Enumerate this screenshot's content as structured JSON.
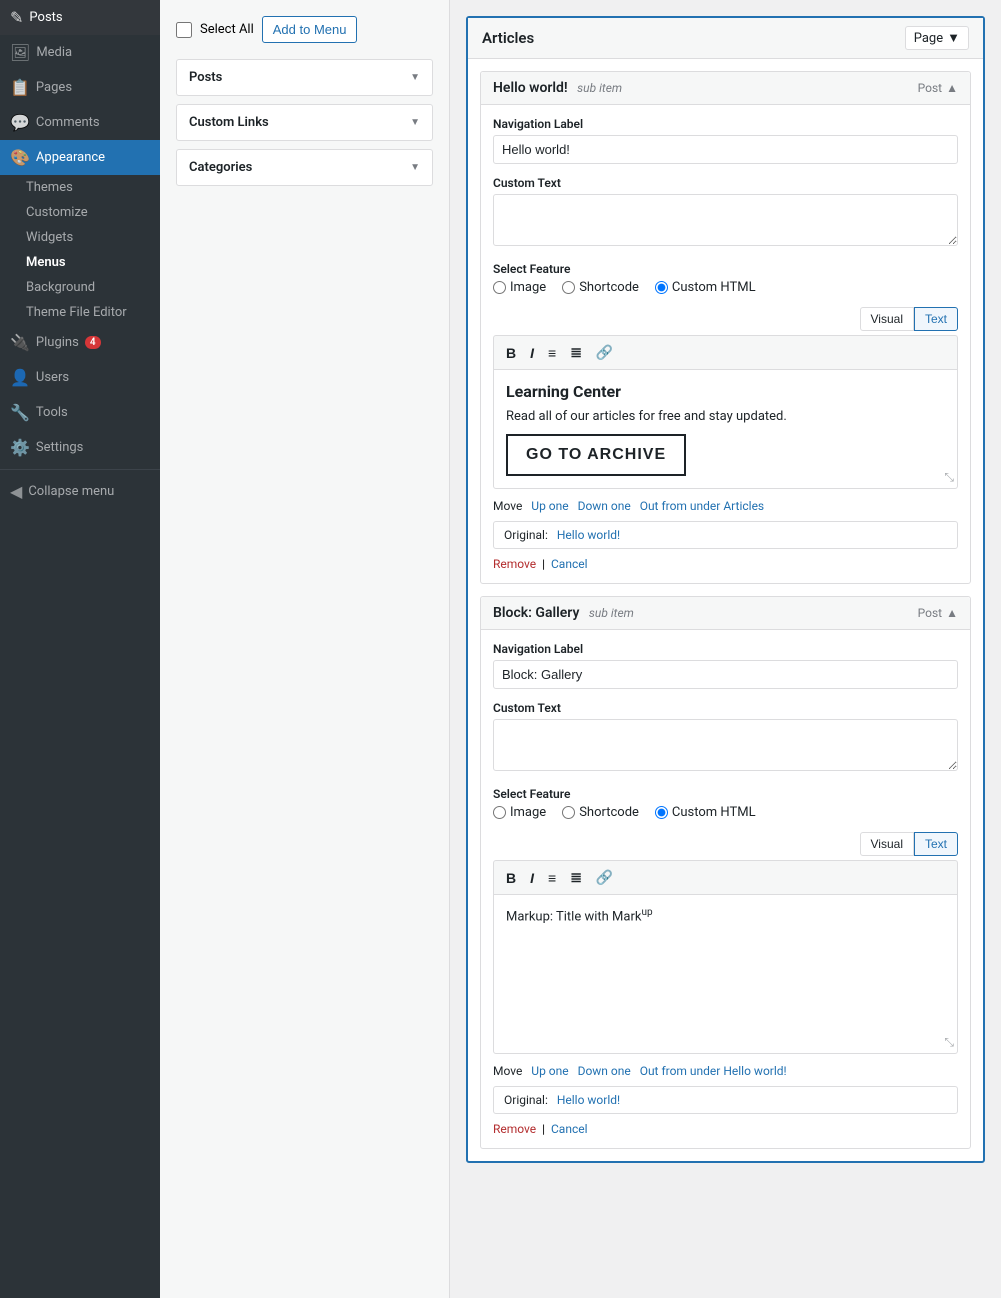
{
  "sidebar": {
    "items": [
      {
        "id": "posts",
        "label": "Posts",
        "icon": "📄",
        "badge": null
      },
      {
        "id": "media",
        "label": "Media",
        "icon": "🖼",
        "badge": null
      },
      {
        "id": "pages",
        "label": "Pages",
        "icon": "📋",
        "badge": null
      },
      {
        "id": "comments",
        "label": "Comments",
        "icon": "💬",
        "badge": null
      },
      {
        "id": "appearance",
        "label": "Appearance",
        "icon": "🎨",
        "badge": null,
        "active": true
      },
      {
        "id": "plugins",
        "label": "Plugins",
        "icon": "🔌",
        "badge": "4"
      },
      {
        "id": "users",
        "label": "Users",
        "icon": "👤",
        "badge": null
      },
      {
        "id": "tools",
        "label": "Tools",
        "icon": "🔧",
        "badge": null
      },
      {
        "id": "settings",
        "label": "Settings",
        "icon": "⚙️",
        "badge": null
      },
      {
        "id": "collapse",
        "label": "Collapse menu",
        "icon": "◀",
        "badge": null
      }
    ],
    "sub_items": [
      {
        "id": "themes",
        "label": "Themes",
        "active": false
      },
      {
        "id": "customize",
        "label": "Customize",
        "active": false
      },
      {
        "id": "widgets",
        "label": "Widgets",
        "active": false
      },
      {
        "id": "menus",
        "label": "Menus",
        "active": true
      },
      {
        "id": "background",
        "label": "Background",
        "active": false
      },
      {
        "id": "theme-file-editor",
        "label": "Theme File Editor",
        "active": false
      }
    ]
  },
  "left_panel": {
    "select_all_label": "Select All",
    "add_to_menu_label": "Add to Menu",
    "accordion_sections": [
      {
        "id": "posts",
        "label": "Posts"
      },
      {
        "id": "custom-links",
        "label": "Custom Links"
      },
      {
        "id": "categories",
        "label": "Categories"
      }
    ]
  },
  "right_panel": {
    "articles_title": "Articles",
    "page_label": "Page",
    "menu_items": [
      {
        "id": "hello-world",
        "title": "Hello world!",
        "sub_item_label": "sub item",
        "post_label": "Post",
        "nav_label_field": "Navigation Label",
        "nav_label_value": "Hello world!",
        "custom_text_field": "Custom Text",
        "custom_text_value": "",
        "select_feature_label": "Select Feature",
        "features": [
          "Image",
          "Shortcode",
          "Custom HTML"
        ],
        "selected_feature": "Custom HTML",
        "visual_tab": "Visual",
        "text_tab": "Text",
        "active_tab": "Text",
        "editor_content_heading": "Learning Center",
        "editor_content_para": "Read all of our articles for free and stay updated.",
        "editor_content_btn": "GO TO ARCHIVE",
        "move_label": "Move",
        "move_up": "Up one",
        "move_down": "Down one",
        "move_out": "Out from under Articles",
        "original_label": "Original:",
        "original_link": "Hello world!",
        "remove_label": "Remove",
        "cancel_label": "Cancel"
      },
      {
        "id": "block-gallery",
        "title": "Block: Gallery",
        "sub_item_label": "sub item",
        "post_label": "Post",
        "nav_label_field": "Navigation Label",
        "nav_label_value": "Block: Gallery",
        "custom_text_field": "Custom Text",
        "custom_text_value": "",
        "select_feature_label": "Select Feature",
        "features": [
          "Image",
          "Shortcode",
          "Custom HTML"
        ],
        "selected_feature": "Custom HTML",
        "visual_tab": "Visual",
        "text_tab": "Text",
        "active_tab": "Text",
        "editor_content_markup": "Markup: Title with Mark",
        "editor_content_sup": "up",
        "move_label": "Move",
        "move_up": "Up one",
        "move_down": "Down one",
        "move_out": "Out from under Hello world!",
        "original_label": "Original:",
        "original_link": "Hello world!",
        "remove_label": "Remove",
        "cancel_label": "Cancel"
      }
    ]
  }
}
